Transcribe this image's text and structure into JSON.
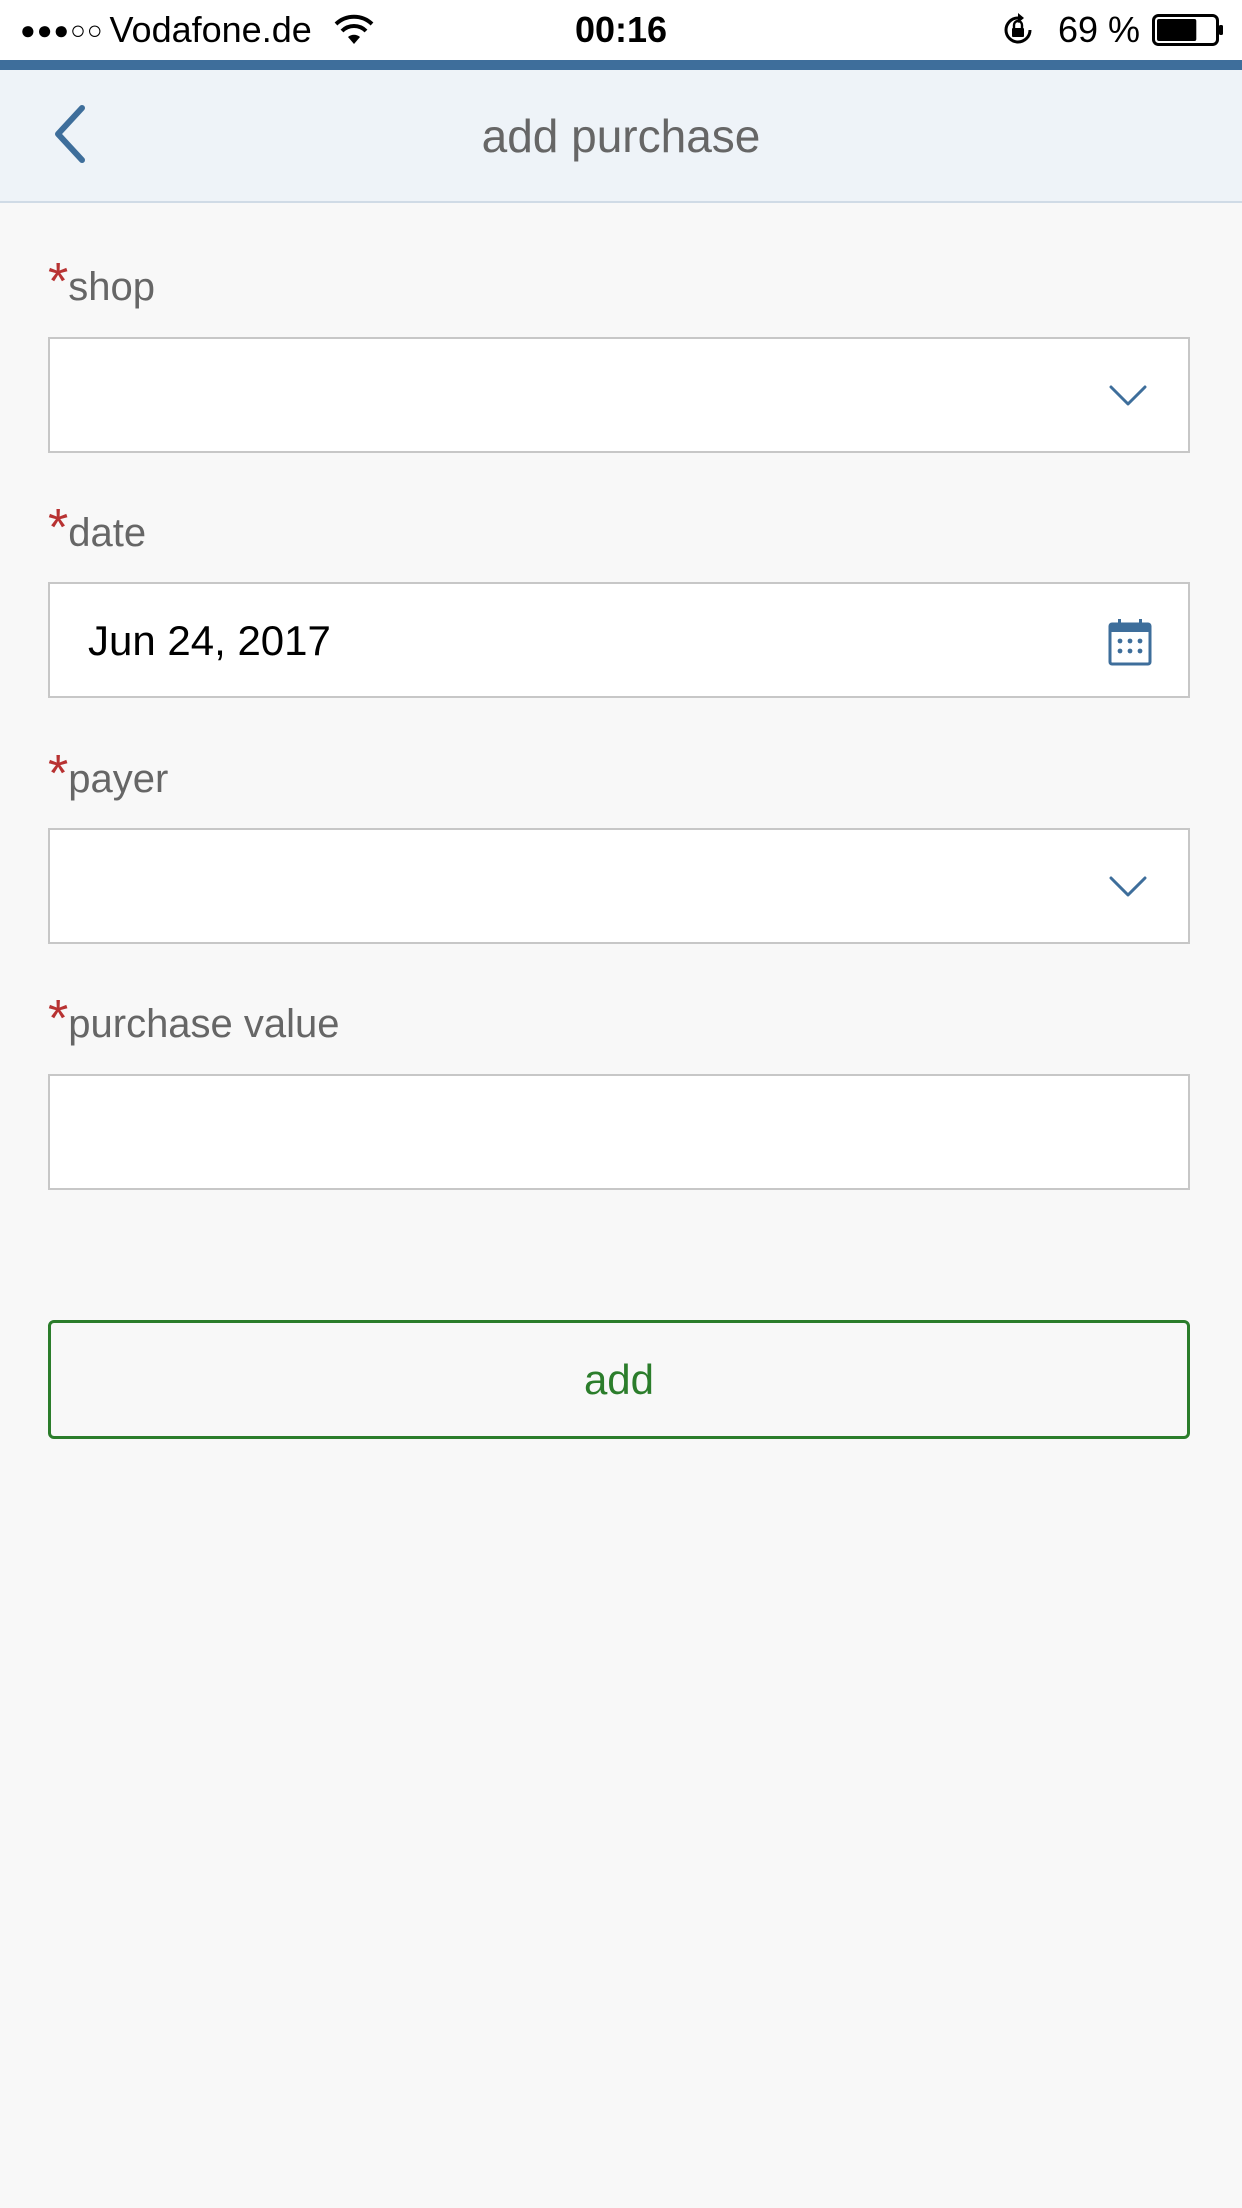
{
  "status_bar": {
    "signal": "●●●○○",
    "carrier": "Vodafone.de",
    "time": "00:16",
    "battery": "69 %",
    "battery_level": 0.69
  },
  "nav": {
    "title": "add purchase",
    "back_icon": "chevron-left-icon"
  },
  "form": {
    "required_marker": "*",
    "shop": {
      "label": "shop",
      "value": ""
    },
    "date": {
      "label": "date",
      "value": "Jun 24, 2017"
    },
    "payer": {
      "label": "payer",
      "value": ""
    },
    "purchase_value": {
      "label": "purchase value",
      "value": ""
    }
  },
  "actions": {
    "add_label": "add"
  },
  "colors": {
    "accent": "#3e6e9b",
    "required": "#b83232",
    "add_button": "#2b7d2b",
    "nav_background": "#eef3f8"
  }
}
